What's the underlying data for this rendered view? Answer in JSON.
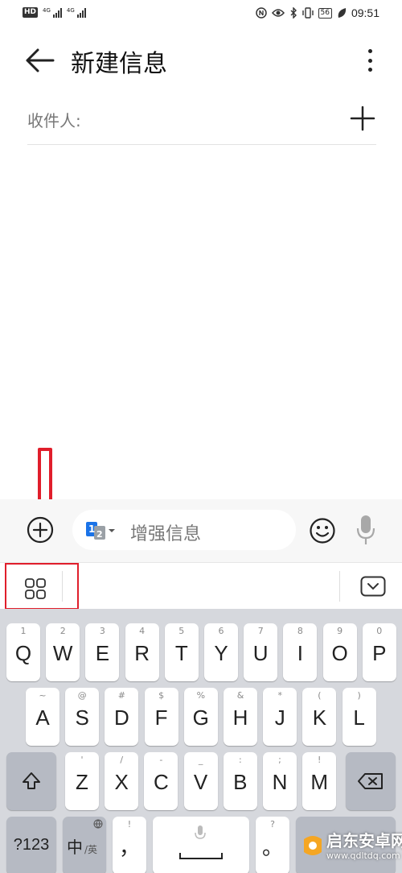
{
  "status_bar": {
    "hd_label": "HD",
    "network_1": "4G",
    "network_2": "4G",
    "battery": "56",
    "time": "09:51"
  },
  "header": {
    "title": "新建信息"
  },
  "recipient": {
    "label": "收件人:"
  },
  "compose": {
    "sim_badge_1": "1",
    "sim_badge_2": "2",
    "placeholder": "增强信息"
  },
  "keyboard": {
    "row1": [
      {
        "hint": "1",
        "key": "Q"
      },
      {
        "hint": "2",
        "key": "W"
      },
      {
        "hint": "3",
        "key": "E"
      },
      {
        "hint": "4",
        "key": "R"
      },
      {
        "hint": "5",
        "key": "T"
      },
      {
        "hint": "6",
        "key": "Y"
      },
      {
        "hint": "7",
        "key": "U"
      },
      {
        "hint": "8",
        "key": "I"
      },
      {
        "hint": "9",
        "key": "O"
      },
      {
        "hint": "0",
        "key": "P"
      }
    ],
    "row2": [
      {
        "hint": "~",
        "key": "A"
      },
      {
        "hint": "@",
        "key": "S"
      },
      {
        "hint": "#",
        "key": "D"
      },
      {
        "hint": "$",
        "key": "F"
      },
      {
        "hint": "%",
        "key": "G"
      },
      {
        "hint": "&",
        "key": "H"
      },
      {
        "hint": "*",
        "key": "J"
      },
      {
        "hint": "(",
        "key": "K"
      },
      {
        "hint": ")",
        "key": "L"
      }
    ],
    "row3": [
      {
        "hint": "'",
        "key": "Z"
      },
      {
        "hint": "/",
        "key": "X"
      },
      {
        "hint": "-",
        "key": "C"
      },
      {
        "hint": "_",
        "key": "V"
      },
      {
        "hint": ":",
        "key": "B"
      },
      {
        "hint": ";",
        "key": "N"
      },
      {
        "hint": "!",
        "key": "M"
      }
    ],
    "num_key": "?123",
    "lang_key_main": "中",
    "lang_key_sub": "/英",
    "punct_key_hint": "!",
    "punct_key": "，",
    "punct2_key_hint": "?",
    "punct2_key": "。"
  },
  "watermark": {
    "line1": "启东安卓网",
    "line2": "www.qdltdq.com"
  },
  "colors": {
    "annotation_red": "#e01e2b",
    "keyboard_bg": "#d6d8dd",
    "key_bg": "#ffffff",
    "fn_key_bg": "#b6bac3",
    "sim_blue": "#1a73e8"
  }
}
